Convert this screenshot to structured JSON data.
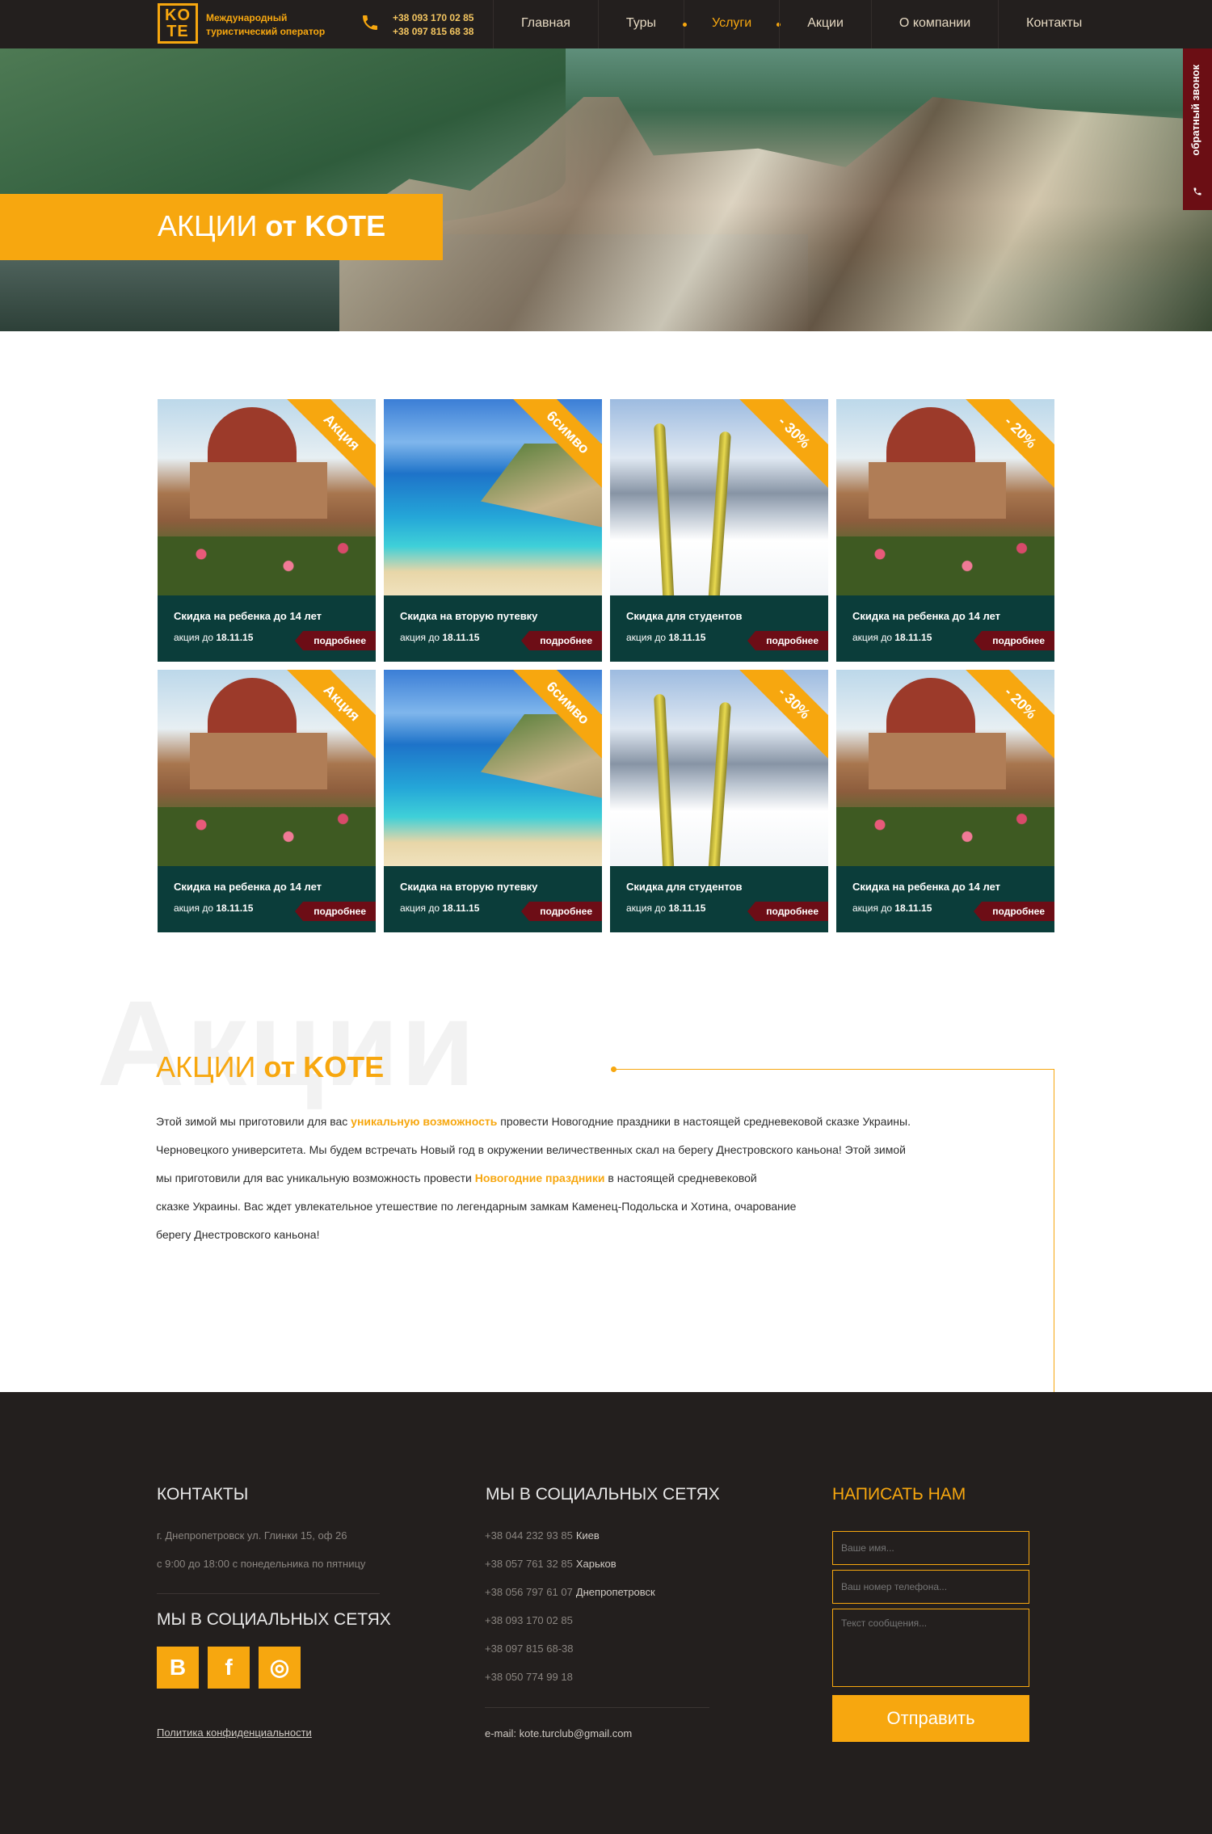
{
  "header": {
    "logo_top": "KO",
    "logo_bottom": "TE",
    "tagline": "Международный туристический оператор",
    "phones": [
      "+38 093 170 02 85",
      "+38 097 815 68 38"
    ],
    "nav": [
      "Главная",
      "Туры",
      "Услуги",
      "Акции",
      "О компании",
      "Контакты"
    ],
    "nav_active": "Услуги",
    "accent": "#f7a70f"
  },
  "hero": {
    "title_light": "АКЦИИ",
    "title_bold": "от KOTE",
    "callback": "обратный звонок"
  },
  "cards": [
    {
      "img": "mosque",
      "badge": "Акция",
      "title": "Скидка на ребенка до 14 лет",
      "date_prefix": "акция до",
      "date": "18.11.15",
      "more": "подробнее"
    },
    {
      "img": "sea",
      "badge": "6симво",
      "title": "Скидка на вторую путевку",
      "date_prefix": "акция до",
      "date": "18.11.15",
      "more": "подробнее"
    },
    {
      "img": "ski",
      "badge": "- 30%",
      "title": "Скидка для студентов",
      "date_prefix": "акция до",
      "date": "18.11.15",
      "more": "подробнее"
    },
    {
      "img": "mosque",
      "badge": "- 20%",
      "title": "Скидка на ребенка до 14 лет",
      "date_prefix": "акция до",
      "date": "18.11.15",
      "more": "подробнее"
    },
    {
      "img": "mosque",
      "badge": "Акция",
      "title": "Скидка на ребенка до 14 лет",
      "date_prefix": "акция до",
      "date": "18.11.15",
      "more": "подробнее"
    },
    {
      "img": "sea",
      "badge": "6симво",
      "title": "Скидка на вторую путевку",
      "date_prefix": "акция до",
      "date": "18.11.15",
      "more": "подробнее"
    },
    {
      "img": "ski",
      "badge": "- 30%",
      "title": "Скидка для студентов",
      "date_prefix": "акция до",
      "date": "18.11.15",
      "more": "подробнее"
    },
    {
      "img": "mosque",
      "badge": "- 20%",
      "title": "Скидка на ребенка до 14 лет",
      "date_prefix": "акция до",
      "date": "18.11.15",
      "more": "подробнее"
    }
  ],
  "about": {
    "watermark": "Акции",
    "title_light": "АКЦИИ",
    "title_bold": "от KOTE",
    "lines": [
      [
        "Этой зимой мы приготовили для вас ",
        {
          "hl": "уникальную возможность"
        },
        " провести Новогодние праздники в настоящей средневековой сказке Украины."
      ],
      [
        "Черновецкого университета. Мы будем встречать Новый год в окружении величественных скал на берегу Днестровского каньона! Этой зимой"
      ],
      [
        "мы приготовили для вас уникальную возможность провести ",
        {
          "hl": "Новогодние праздники"
        },
        " в настоящей средневековой"
      ],
      [
        "сказке Украины. Вас ждет увлекательное утешествие по легендарным замкам Каменец-Подольска и Хотина, очарование"
      ],
      [
        "берегу Днестровского каньона!"
      ]
    ]
  },
  "footer": {
    "contacts_title": "КОНТАКТЫ",
    "address": "г. Днепропетровск ул. Глинки 15, оф 26",
    "hours": "с 9:00 до 18:00 с понедельника по пятницу",
    "social_title_left": "МЫ В СОЦИАЛЬНЫХ СЕТЯХ",
    "social_buttons": [
      "В",
      "f",
      "◎"
    ],
    "policy": "Политика конфиденциальности",
    "social_title_mid": "МЫ В СОЦИАЛЬНЫХ СЕТЯХ",
    "phones": [
      {
        "num": "+38 044 232 93 85",
        "city": "Киев"
      },
      {
        "num": "+38 057 761 32 85",
        "city": "Харьков"
      },
      {
        "num": "+38 056 797 61 07",
        "city": "Днепропетровск"
      },
      {
        "num": "+38 093 170 02 85",
        "city": ""
      },
      {
        "num": "+38 097 815 68-38",
        "city": ""
      },
      {
        "num": "+38 050 774 99 18",
        "city": ""
      }
    ],
    "email": "e-mail: kote.turclub@gmail.com",
    "write_title": "НАПИСАТЬ НАМ",
    "name_placeholder": "Ваше имя...",
    "phone_placeholder": "Ваш номер телефона...",
    "message_placeholder": "Текст сообщения...",
    "send": "Отправить"
  }
}
